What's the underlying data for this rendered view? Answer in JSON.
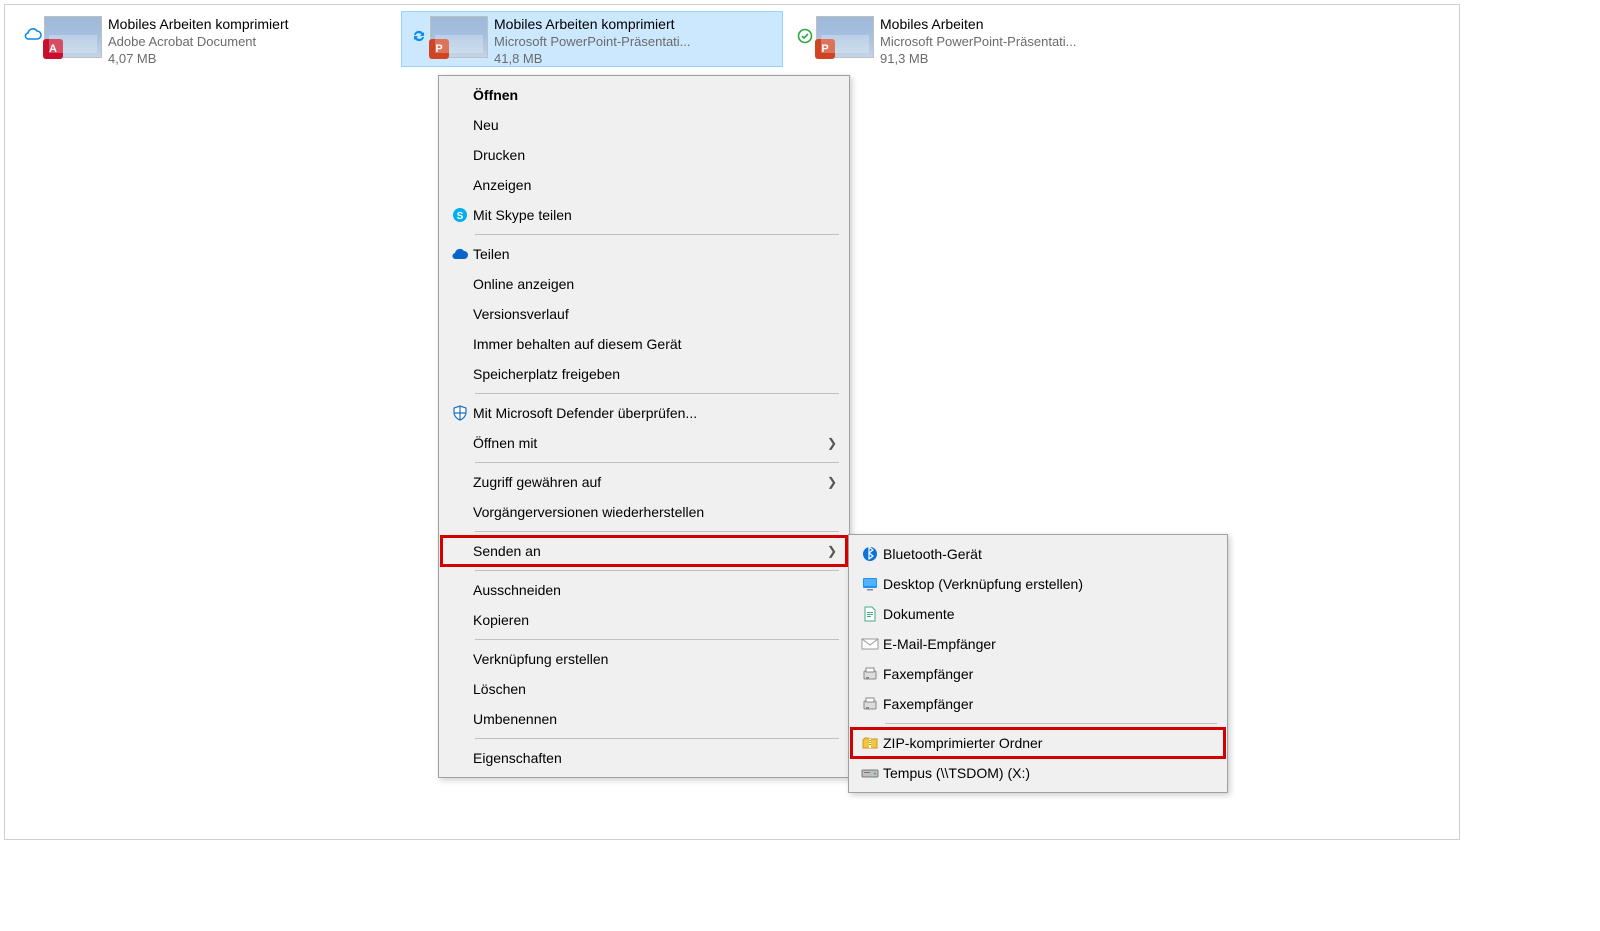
{
  "files": [
    {
      "status": "cloud",
      "name": "Mobiles Arbeiten komprimiert",
      "type_label": "Adobe Acrobat Document",
      "size": "4,07 MB",
      "badge": "pdf",
      "badge_letter": "A"
    },
    {
      "status": "sync",
      "name": "Mobiles Arbeiten komprimiert",
      "type_label": "Microsoft PowerPoint-Präsentati...",
      "size": "41,8 MB",
      "badge": "ppt",
      "badge_letter": "P"
    },
    {
      "status": "synced",
      "name": "Mobiles Arbeiten",
      "type_label": "Microsoft PowerPoint-Präsentati...",
      "size": "91,3 MB",
      "badge": "ppt",
      "badge_letter": "P"
    }
  ],
  "context_menu": {
    "groups": [
      [
        {
          "label": "Öffnen",
          "bold": true,
          "icon": ""
        },
        {
          "label": "Neu",
          "icon": ""
        },
        {
          "label": "Drucken",
          "icon": ""
        },
        {
          "label": "Anzeigen",
          "icon": ""
        },
        {
          "label": "Mit Skype teilen",
          "icon": "skype"
        }
      ],
      [
        {
          "label": "Teilen",
          "icon": "cloud-blue"
        },
        {
          "label": "Online anzeigen",
          "icon": ""
        },
        {
          "label": "Versionsverlauf",
          "icon": ""
        },
        {
          "label": "Immer behalten auf diesem Gerät",
          "icon": ""
        },
        {
          "label": "Speicherplatz freigeben",
          "icon": ""
        }
      ],
      [
        {
          "label": "Mit Microsoft Defender überprüfen...",
          "icon": "defender"
        },
        {
          "label": "Öffnen mit",
          "icon": "",
          "submenu": true
        }
      ],
      [
        {
          "label": "Zugriff gewähren auf",
          "icon": "",
          "submenu": true
        },
        {
          "label": "Vorgängerversionen wiederherstellen",
          "icon": ""
        }
      ],
      [
        {
          "label": "Senden an",
          "icon": "",
          "submenu": true,
          "highlight": true
        }
      ],
      [
        {
          "label": "Ausschneiden",
          "icon": ""
        },
        {
          "label": "Kopieren",
          "icon": ""
        }
      ],
      [
        {
          "label": "Verknüpfung erstellen",
          "icon": ""
        },
        {
          "label": "Löschen",
          "icon": ""
        },
        {
          "label": "Umbenennen",
          "icon": ""
        }
      ],
      [
        {
          "label": "Eigenschaften",
          "icon": ""
        }
      ]
    ]
  },
  "submenu": {
    "items": [
      {
        "label": "Bluetooth-Gerät",
        "icon": "bluetooth"
      },
      {
        "label": "Desktop (Verknüpfung erstellen)",
        "icon": "desktop"
      },
      {
        "label": "Dokumente",
        "icon": "doc"
      },
      {
        "label": "E-Mail-Empfänger",
        "icon": "mail"
      },
      {
        "label": "Faxempfänger",
        "icon": "fax"
      },
      {
        "label": "Faxempfänger",
        "icon": "fax"
      }
    ],
    "sep_after": true,
    "items2": [
      {
        "label": "ZIP-komprimierter Ordner",
        "icon": "zip",
        "highlight": true
      },
      {
        "label": "Tempus (\\\\TSDOM) (X:)",
        "icon": "drive"
      }
    ]
  }
}
